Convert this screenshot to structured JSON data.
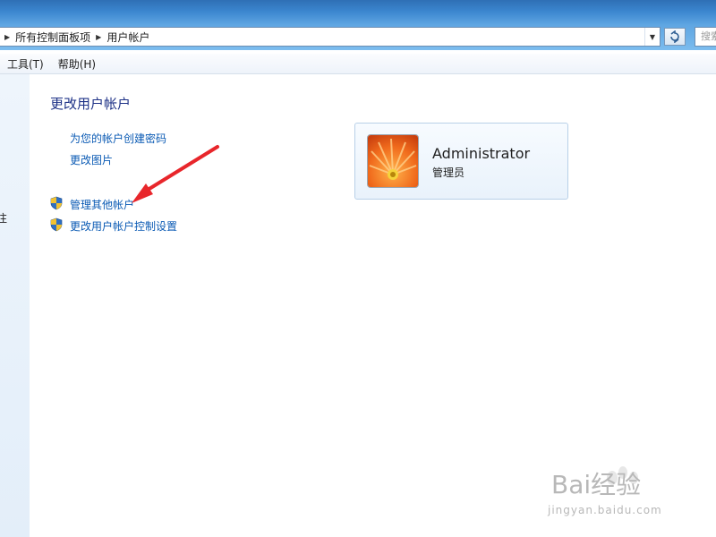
{
  "address_bar": {
    "breadcrumbs": [
      "所有控制面板项",
      "用户帐户"
    ],
    "search_placeholder": "搜索"
  },
  "menubar": {
    "items": [
      "工具(T)",
      "帮助(H)"
    ]
  },
  "left_pane": {
    "fragment": "往"
  },
  "main": {
    "title": "更改用户帐户",
    "links": [
      "为您的帐户创建密码",
      "更改图片"
    ],
    "shield_links": [
      "管理其他帐户",
      "更改用户帐户控制设置"
    ]
  },
  "account": {
    "name": "Administrator",
    "role": "管理员"
  },
  "watermark": {
    "brand": "Bai经验",
    "url": "jingyan.baidu.com"
  },
  "colors": {
    "link": "#0a5ab4",
    "title": "#1e3287",
    "annotation_arrow": "#e8262b"
  }
}
